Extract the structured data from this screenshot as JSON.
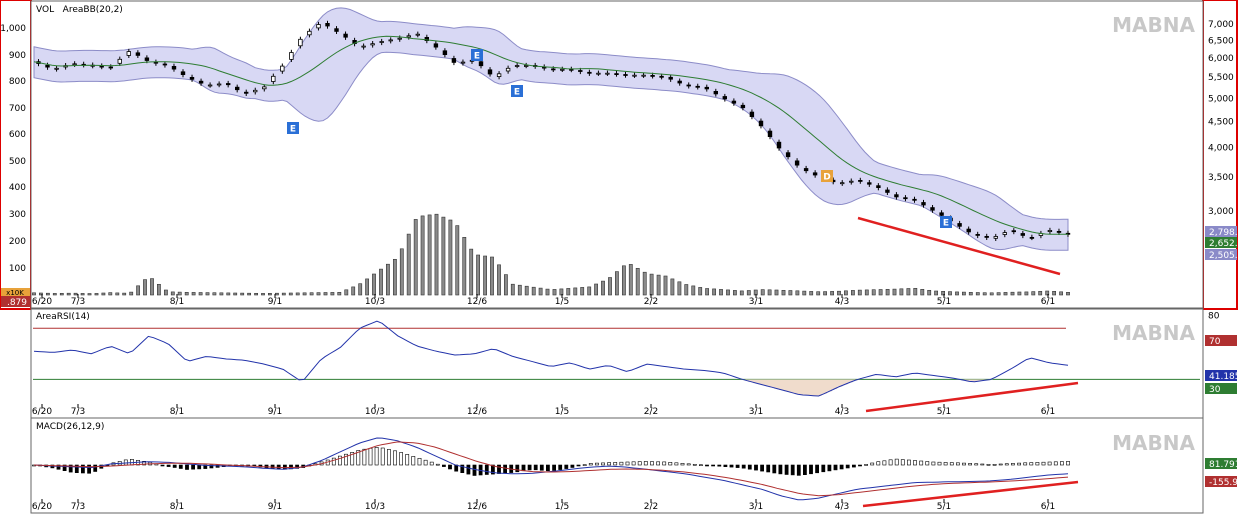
{
  "chart_data": [
    {
      "type": "candlestick",
      "title": "VOL   AreaBB(20,2)",
      "watermark": "MABNA",
      "x_ticks": [
        "6/20",
        "7/3",
        "8/1",
        "9/1",
        "10/3",
        "12/6",
        "1/5",
        "2/2",
        "3/1",
        "4/3",
        "5/1",
        "6/1"
      ],
      "left_axis_ticks": [
        "100",
        "200",
        "300",
        "400",
        "500",
        "600",
        "700",
        "800",
        "900",
        "1,000"
      ],
      "right_axis_ticks": [
        "3,000",
        "3,500",
        "4,000",
        "4,500",
        "5,000",
        "5,500",
        "6,000",
        "6,500",
        "7,000"
      ],
      "left_bottom_tag": ".879",
      "left_mid_tag": "x10K",
      "right_tags": [
        {
          "text": "2,798.3",
          "color": "#8a8ac8"
        },
        {
          "text": "2,652.3",
          "color": "#2e7d32"
        },
        {
          "text": "2,505.9",
          "color": "#8a8ac8"
        }
      ],
      "events": [
        {
          "x": "9/8",
          "label": "E",
          "color": "#2a6fd6"
        },
        {
          "x": "12/7",
          "label": "E",
          "color": "#2a6fd6"
        },
        {
          "x": "12/20",
          "label": "E",
          "color": "#2a6fd6"
        },
        {
          "x": "4/3",
          "label": "D",
          "color": "#e8a23a"
        },
        {
          "x": "4/28",
          "label": "E",
          "color": "#2a6fd6"
        }
      ],
      "price_path_keypoints": [
        5900,
        5700,
        5850,
        5800,
        5750,
        6200,
        5900,
        5800,
        5500,
        5300,
        5350,
        5100,
        5250,
        5800,
        6600,
        7050,
        6700,
        6300,
        6450,
        6550,
        6700,
        6300,
        5850,
        5950,
        5500,
        5800,
        5800,
        5700,
        5700,
        5600,
        5600,
        5550,
        5550,
        5500,
        5300,
        5250,
        5000,
        4800,
        4400,
        3950,
        3650,
        3500,
        3400,
        3450,
        3350,
        3200,
        3150,
        3000,
        2850,
        2700,
        2650,
        2750,
        2650,
        2750,
        2700
      ],
      "volume_keypoints": [
        8,
        6,
        7,
        5,
        9,
        6,
        70,
        12,
        10,
        9,
        8,
        7,
        6,
        7,
        8,
        9,
        10,
        40,
        90,
        140,
        290,
        300,
        270,
        150,
        140,
        40,
        30,
        20,
        25,
        30,
        60,
        120,
        80,
        70,
        40,
        25,
        20,
        15,
        20,
        18,
        15,
        12,
        14,
        18,
        20,
        22,
        25,
        15,
        12,
        10,
        8,
        10,
        12,
        15,
        10
      ]
    },
    {
      "type": "line",
      "title": "AreaRSI(14)",
      "watermark": "MABNA",
      "y_ticks": [
        "80"
      ],
      "levels": [
        70,
        30
      ],
      "right_tags": [
        {
          "text": "70",
          "color": "#b03030"
        },
        {
          "text": "41.185",
          "color": "#2233aa"
        },
        {
          "text": "30",
          "color": "#2e7d32"
        }
      ],
      "x_ticks": [
        "6/20",
        "7/3",
        "8/1",
        "9/1",
        "10/3",
        "12/6",
        "1/5",
        "2/2",
        "3/1",
        "4/3",
        "5/1",
        "6/1"
      ],
      "series": [
        {
          "name": "RSI",
          "values": [
            52,
            51,
            53,
            50,
            56,
            50,
            64,
            58,
            44,
            48,
            46,
            45,
            42,
            38,
            28,
            46,
            55,
            70,
            76,
            64,
            56,
            52,
            49,
            50,
            54,
            48,
            44,
            40,
            43,
            38,
            41,
            36,
            42,
            40,
            38,
            37,
            35,
            30,
            26,
            22,
            18,
            17,
            24,
            30,
            34,
            32,
            35,
            33,
            31,
            28,
            30,
            38,
            47,
            43,
            41
          ]
        }
      ]
    },
    {
      "type": "bar",
      "title": "MACD(26,12,9)",
      "watermark": "MABNA",
      "x_ticks": [
        "6/20",
        "7/3",
        "8/1",
        "9/1",
        "10/3",
        "12/6",
        "1/5",
        "2/2",
        "3/1",
        "4/3",
        "5/1",
        "6/1"
      ],
      "right_tags": [
        {
          "text": "81.791",
          "color": "#2e7d32"
        },
        {
          "text": "-155.92",
          "color": "#b03030"
        }
      ],
      "series": [
        {
          "name": "histogram",
          "values": [
            0,
            -10,
            -25,
            -28,
            5,
            20,
            10,
            -5,
            -15,
            -12,
            -5,
            0,
            -8,
            -15,
            -10,
            10,
            30,
            50,
            60,
            45,
            25,
            5,
            -20,
            -35,
            -30,
            -25,
            -15,
            -20,
            -10,
            5,
            8,
            10,
            12,
            10,
            5,
            0,
            -5,
            -10,
            -20,
            -30,
            -35,
            -25,
            -15,
            -5,
            10,
            20,
            15,
            10,
            8,
            5,
            2,
            5,
            8,
            10,
            12
          ]
        },
        {
          "name": "MACD",
          "values": [
            0,
            -5,
            -8,
            -12,
            5,
            10,
            15,
            12,
            5,
            -2,
            -5,
            -8,
            -15,
            -20,
            -10,
            20,
            60,
            100,
            125,
            110,
            80,
            40,
            0,
            -20,
            -35,
            -40,
            -38,
            -30,
            -20,
            -10,
            -5,
            -10,
            -20,
            -30,
            -40,
            -55,
            -70,
            -90,
            -110,
            -140,
            -160,
            -150,
            -130,
            -110,
            -100,
            -90,
            -80,
            -78,
            -76,
            -75,
            -72,
            -65,
            -55,
            -45,
            -40
          ]
        },
        {
          "name": "Signal",
          "values": [
            0,
            -3,
            -5,
            -8,
            -5,
            0,
            5,
            8,
            8,
            5,
            0,
            -3,
            -8,
            -12,
            -10,
            5,
            30,
            60,
            90,
            105,
            100,
            80,
            50,
            20,
            -5,
            -20,
            -30,
            -32,
            -30,
            -25,
            -20,
            -18,
            -20,
            -25,
            -32,
            -42,
            -55,
            -70,
            -88,
            -110,
            -130,
            -140,
            -135,
            -125,
            -115,
            -105,
            -95,
            -88,
            -83,
            -80,
            -77,
            -73,
            -68,
            -62,
            -55
          ]
        }
      ]
    }
  ]
}
